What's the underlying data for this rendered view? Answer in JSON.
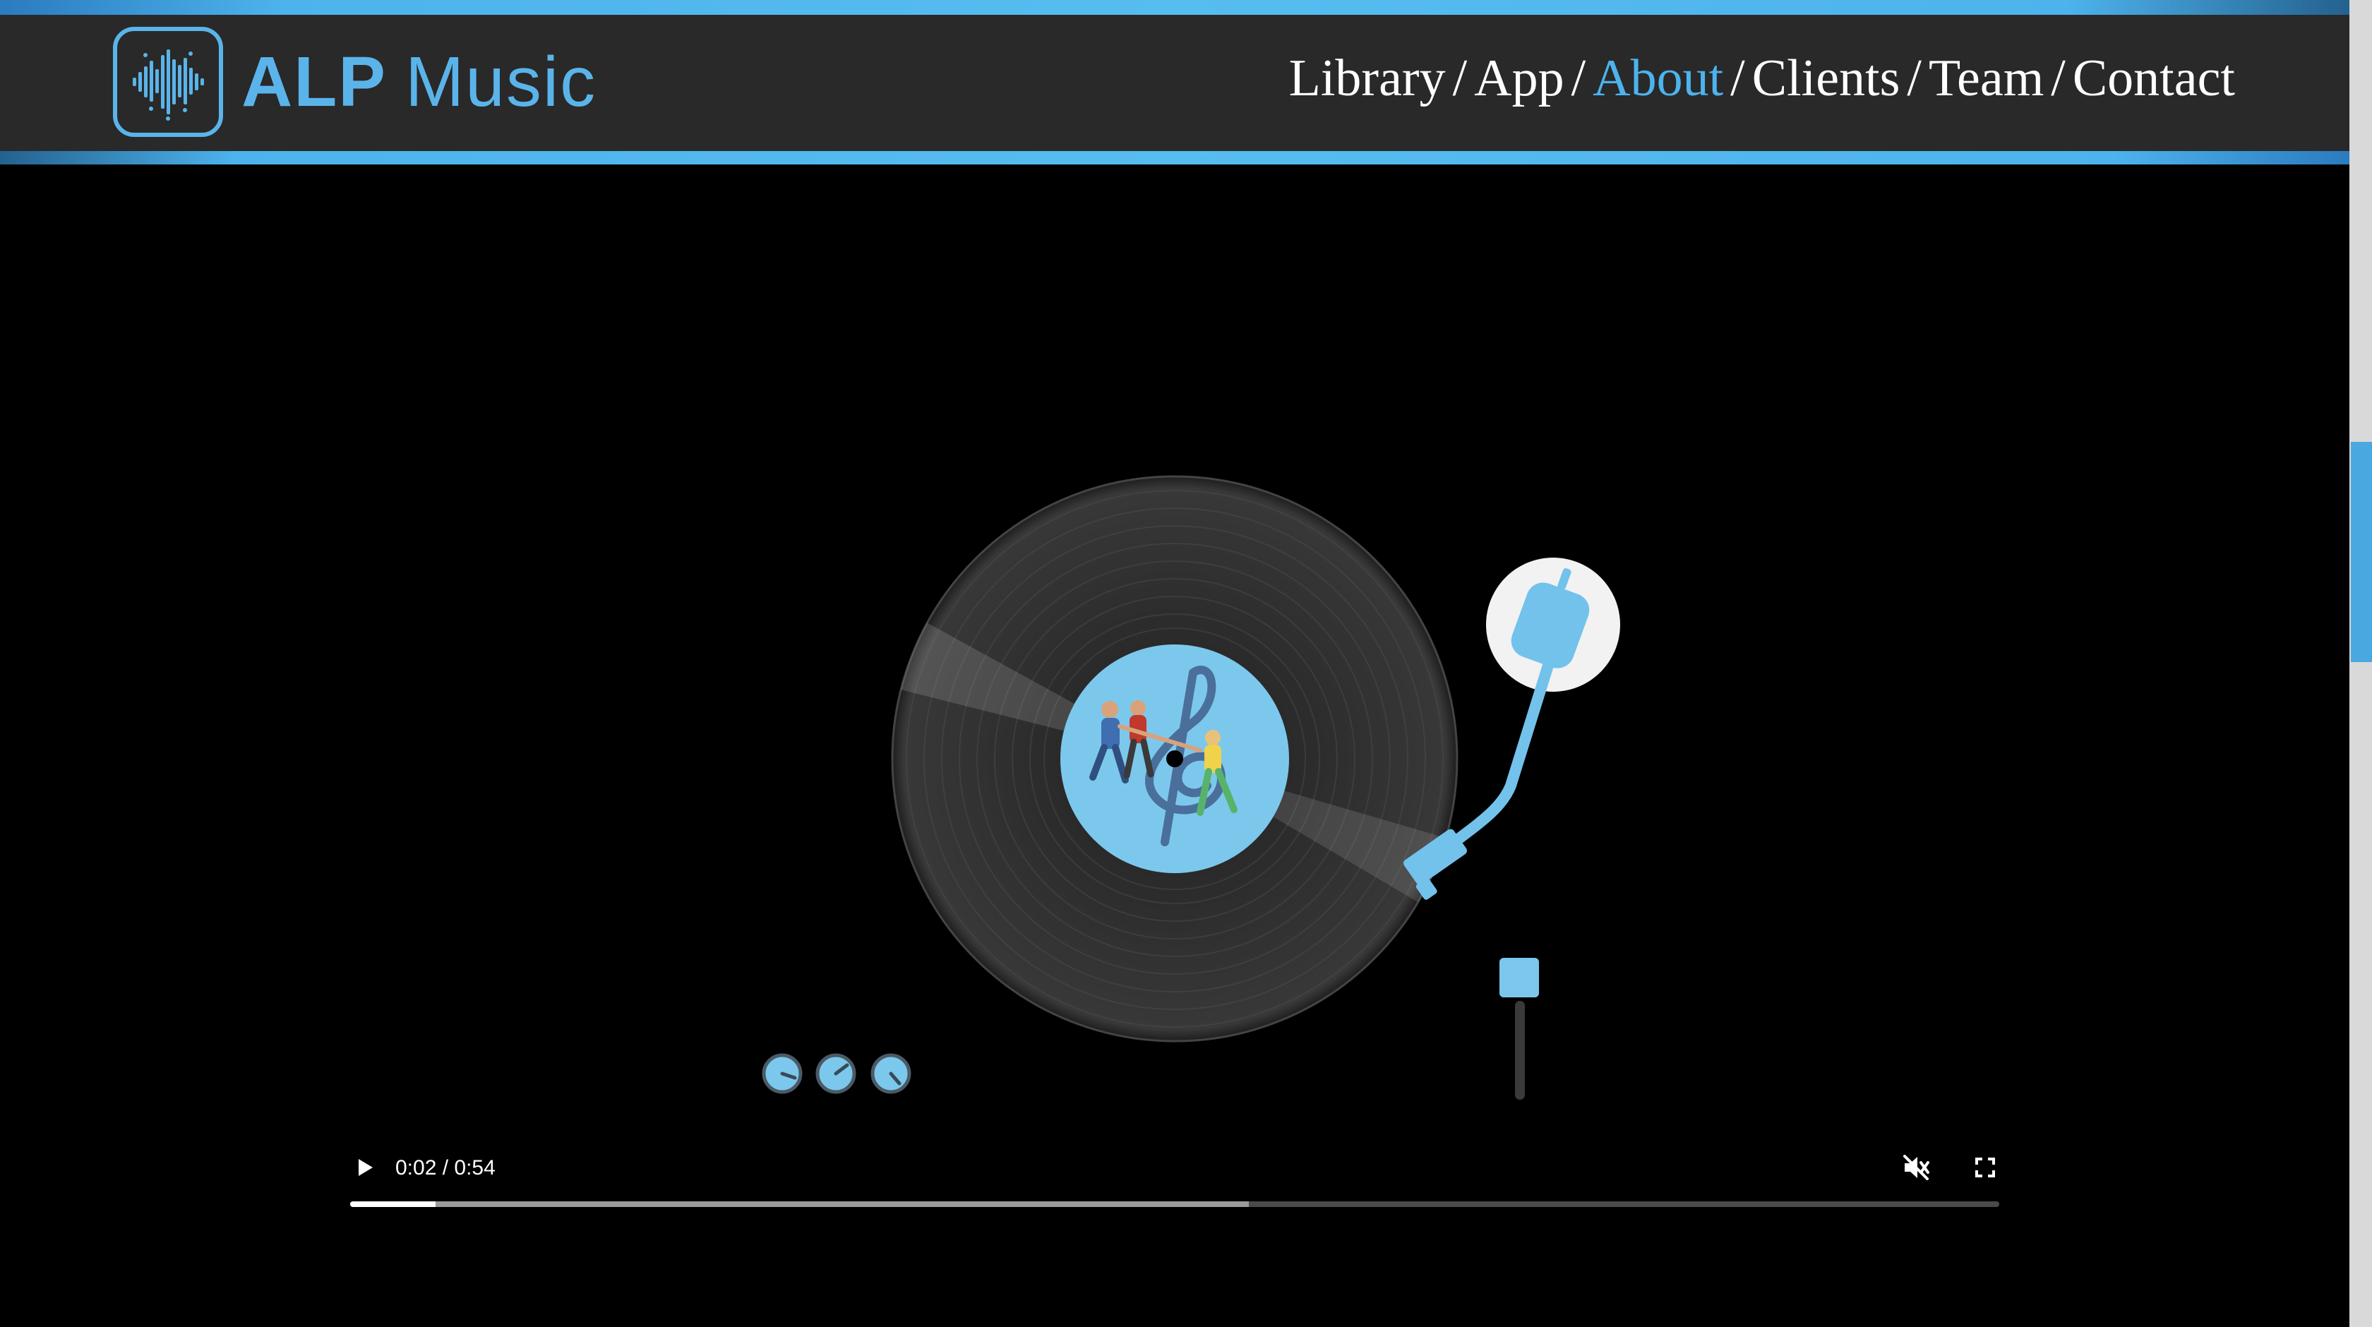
{
  "brand": {
    "name_bold": "ALP",
    "name_light": "Music",
    "accent_color": "#5ab4ea"
  },
  "nav": {
    "items": [
      {
        "label": "Library",
        "active": false
      },
      {
        "label": "App",
        "active": false
      },
      {
        "label": "About",
        "active": true
      },
      {
        "label": "Clients",
        "active": false
      },
      {
        "label": "Team",
        "active": false
      },
      {
        "label": "Contact",
        "active": false
      }
    ],
    "separator": "/"
  },
  "player": {
    "time_display": "0:02 / 0:54",
    "progress_played_fraction": 0.052,
    "progress_buffered_fraction": 0.545,
    "muted": true,
    "play_icon": "play-icon",
    "mute_icon": "muted-speaker-icon",
    "fullscreen_icon": "fullscreen-icon"
  },
  "colors": {
    "header_bg": "#292929",
    "accent": "#4db3ec",
    "label_blue": "#7cc8ec",
    "arm_blue": "#72c2ec"
  }
}
